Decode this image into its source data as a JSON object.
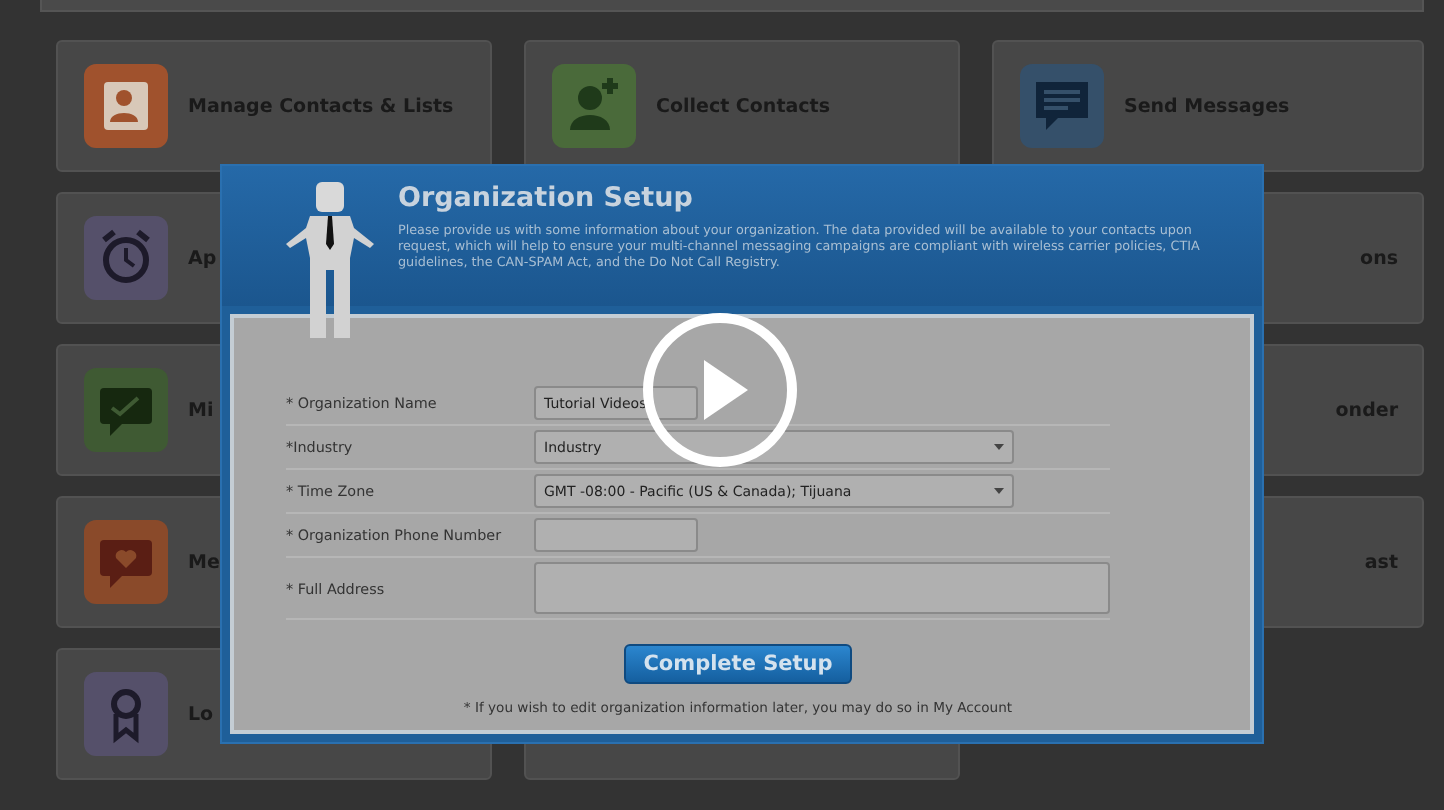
{
  "tiles": [
    {
      "label": "Manage Contacts & Lists"
    },
    {
      "label": "Collect Contacts"
    },
    {
      "label": "Send Messages"
    },
    {
      "label": "Ap"
    },
    {
      "label": "ons"
    },
    {
      "label": "Mi"
    },
    {
      "label": "onder"
    },
    {
      "label": "Me"
    },
    {
      "label": "ast"
    },
    {
      "label": "Lo"
    }
  ],
  "dialog": {
    "title": "Organization Setup",
    "description": "Please provide us with some information about your organization. The data provided will be available to your contacts upon request, which will help to ensure your multi-channel messaging campaigns are compliant with wireless carrier policies, CTIA guidelines, the CAN-SPAM Act, and the Do Not Call Registry.",
    "fields": [
      {
        "label": "* Organization Name",
        "kind": "text",
        "value": "Tutorial Videos"
      },
      {
        "label": "*Industry",
        "kind": "select",
        "value": "Industry"
      },
      {
        "label": "* Time Zone",
        "kind": "select",
        "value": "GMT -08:00 - Pacific (US & Canada); Tijuana"
      },
      {
        "label": "* Organization Phone Number",
        "kind": "text"
      },
      {
        "label": "* Full Address",
        "kind": "textarea"
      }
    ],
    "button": "Complete Setup",
    "footnote": "* If you wish to edit organization information later, you may do so in My Account"
  }
}
